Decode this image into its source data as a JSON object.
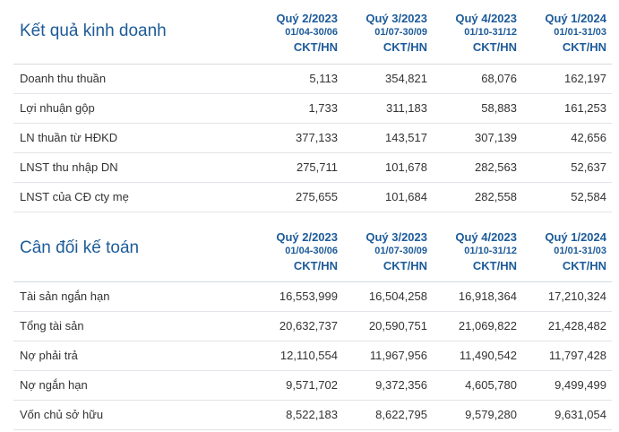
{
  "business_results": {
    "title": "Kết quả kinh doanh",
    "quarters": [
      {
        "label": "Quý 2/2023",
        "range": "01/04-30/06",
        "type": "CKT/HN"
      },
      {
        "label": "Quý 3/2023",
        "range": "01/07-30/09",
        "type": "CKT/HN"
      },
      {
        "label": "Quý 4/2023",
        "range": "01/10-31/12",
        "type": "CKT/HN"
      },
      {
        "label": "Quý 1/2024",
        "range": "01/01-31/03",
        "type": "CKT/HN"
      }
    ],
    "rows": [
      {
        "label": "Doanh thu thuần",
        "values": [
          "5,113",
          "354,821",
          "68,076",
          "162,197"
        ]
      },
      {
        "label": "Lợi nhuận gộp",
        "values": [
          "1,733",
          "311,183",
          "58,883",
          "161,253"
        ]
      },
      {
        "label": "LN thuần từ HĐKD",
        "values": [
          "377,133",
          "143,517",
          "307,139",
          "42,656"
        ]
      },
      {
        "label": "LNST thu nhập DN",
        "values": [
          "275,711",
          "101,678",
          "282,563",
          "52,637"
        ]
      },
      {
        "label": "LNST của CĐ cty mẹ",
        "values": [
          "275,655",
          "101,684",
          "282,558",
          "52,584"
        ]
      }
    ]
  },
  "balance_sheet": {
    "title": "Cân đối kế toán",
    "quarters": [
      {
        "label": "Quý 2/2023",
        "range": "01/04-30/06",
        "type": "CKT/HN"
      },
      {
        "label": "Quý 3/2023",
        "range": "01/07-30/09",
        "type": "CKT/HN"
      },
      {
        "label": "Quý 4/2023",
        "range": "01/10-31/12",
        "type": "CKT/HN"
      },
      {
        "label": "Quý 1/2024",
        "range": "01/01-31/03",
        "type": "CKT/HN"
      }
    ],
    "rows": [
      {
        "label": "Tài sản ngắn hạn",
        "values": [
          "16,553,999",
          "16,504,258",
          "16,918,364",
          "17,210,324"
        ]
      },
      {
        "label": "Tổng tài sản",
        "values": [
          "20,632,737",
          "20,590,751",
          "21,069,822",
          "21,428,482"
        ]
      },
      {
        "label": "Nợ phải trả",
        "values": [
          "12,110,554",
          "11,967,956",
          "11,490,542",
          "11,797,428"
        ]
      },
      {
        "label": "Nợ ngắn hạn",
        "values": [
          "9,571,702",
          "9,372,356",
          "4,605,780",
          "9,499,499"
        ]
      },
      {
        "label": "Vốn chủ sở hữu",
        "values": [
          "8,522,183",
          "8,622,795",
          "9,579,280",
          "9,631,054"
        ]
      }
    ]
  }
}
